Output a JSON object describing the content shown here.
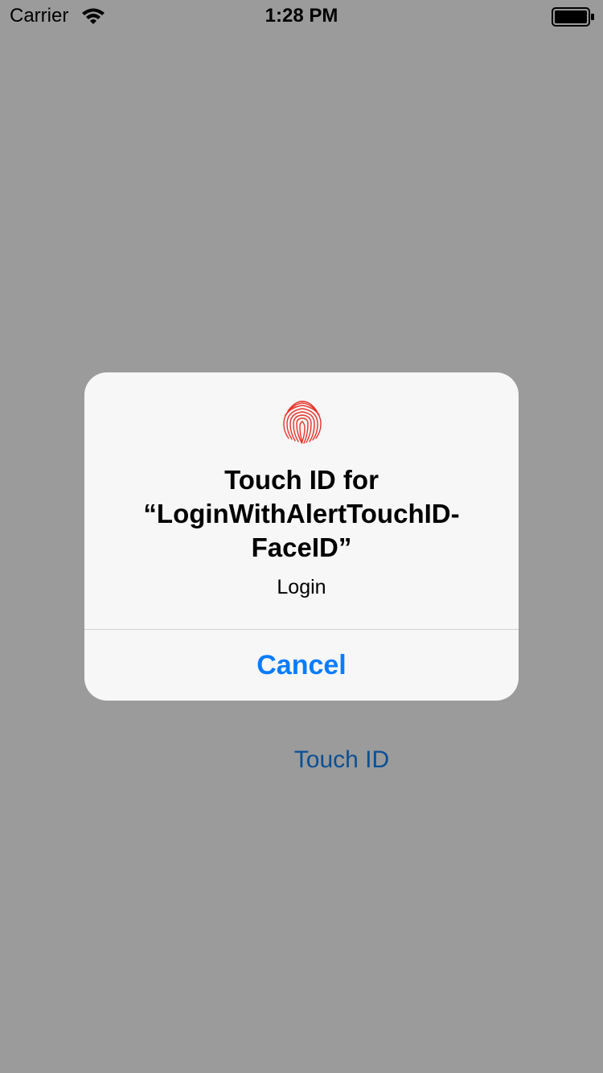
{
  "status_bar": {
    "carrier": "Carrier",
    "time": "1:28 PM",
    "wifi_icon": "wifi-icon",
    "battery_icon": "battery-icon"
  },
  "alert": {
    "icon": "fingerprint-icon",
    "title": "Touch ID for “LoginWithAlertTouchID-FaceID”",
    "message": "Login",
    "cancel_label": "Cancel"
  },
  "background": {
    "touch_id_label": "Touch ID"
  },
  "colors": {
    "background": "#9b9b9b",
    "alert_background": "#f7f7f7",
    "accent": "#0a7cff",
    "background_link": "#0a4f94",
    "fingerprint": "#e6342c"
  }
}
